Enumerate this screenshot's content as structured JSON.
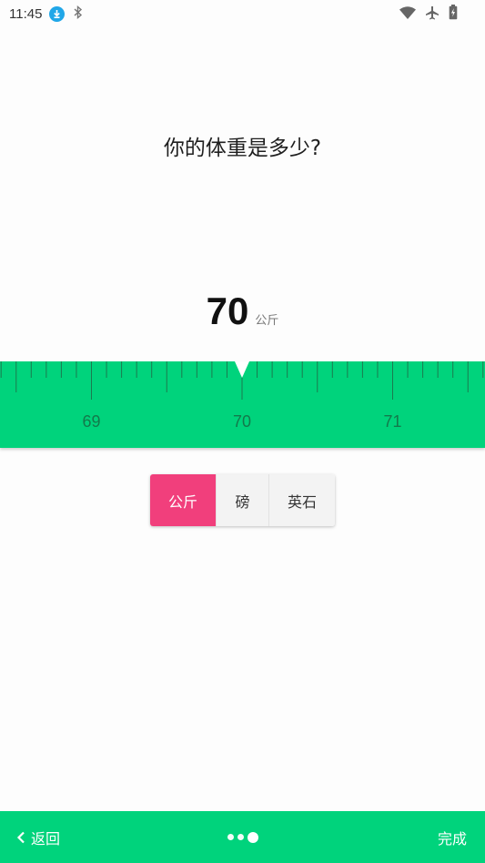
{
  "status_bar": {
    "time": "11:45",
    "left_icons": [
      "download-icon",
      "bluetooth-icon"
    ],
    "right_icons": [
      "wifi-icon",
      "airplane-icon",
      "battery-icon"
    ]
  },
  "question": "你的体重是多少?",
  "weight": {
    "value": "70",
    "unit": "公斤"
  },
  "ruler": {
    "current": 70,
    "labels": [
      "69",
      "70",
      "71"
    ],
    "color": "#00d37c"
  },
  "unit_options": [
    {
      "label": "公斤",
      "selected": true
    },
    {
      "label": "磅",
      "selected": false
    },
    {
      "label": "英石",
      "selected": false
    }
  ],
  "bottom_nav": {
    "back_label": "返回",
    "done_label": "完成",
    "page_dots": 3,
    "current_page": 3,
    "color": "#00d37c"
  },
  "accent_color": "#f13f7c"
}
